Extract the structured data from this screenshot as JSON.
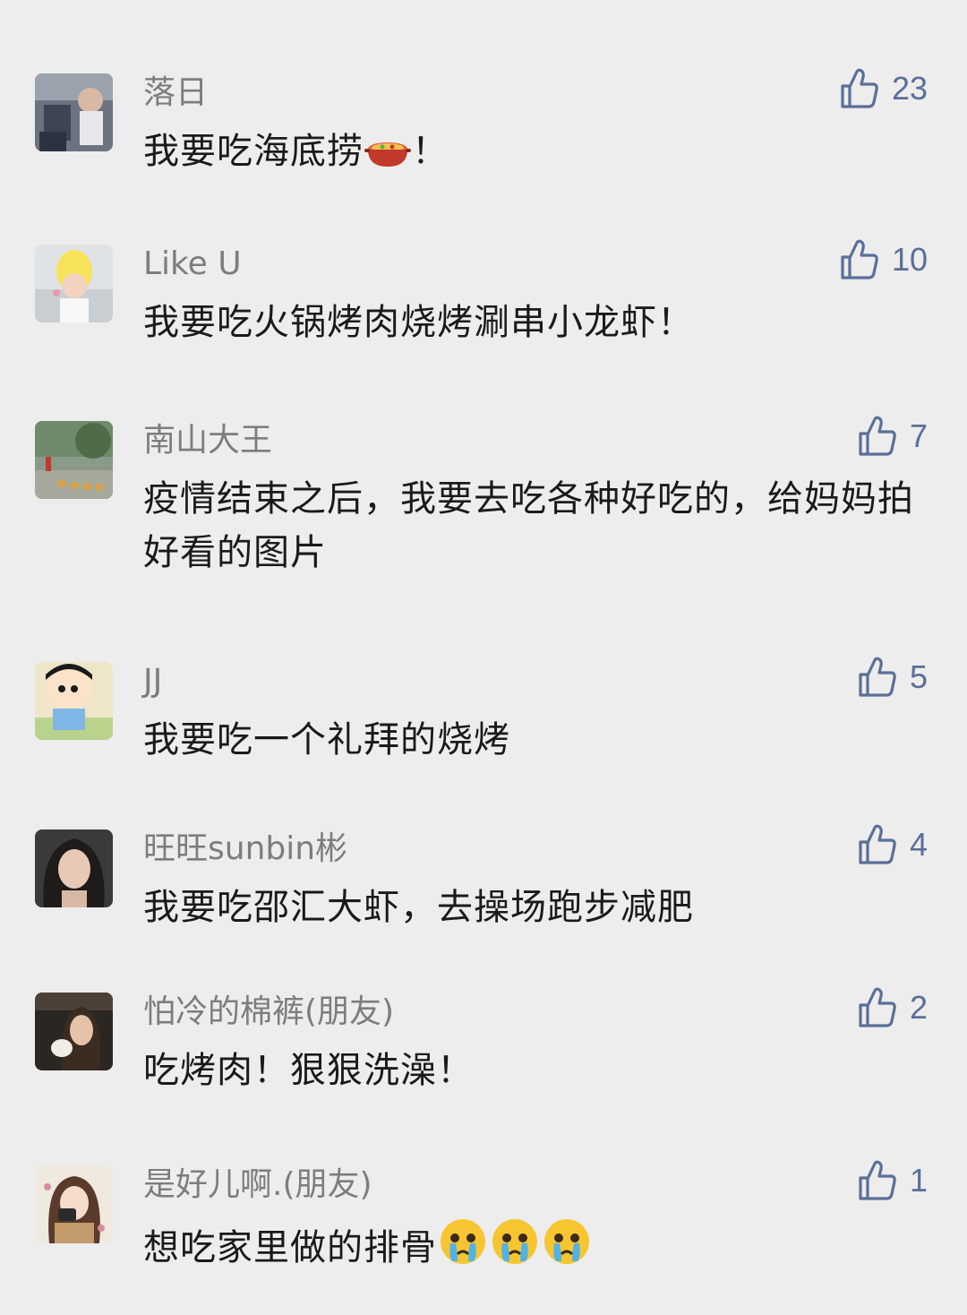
{
  "colors": {
    "background": "#ededed",
    "user_name": "#7d7d7d",
    "comment_text": "#1a1a1a",
    "like_accent": "#5a6f99"
  },
  "comments": [
    {
      "user": "落日",
      "text": "我要吃海底捞",
      "emoji": "hotpot-emoji",
      "text_suffix": "！",
      "likes": "23",
      "like_icon": "thumbs-up-icon"
    },
    {
      "user": "Like U",
      "text": "我要吃火锅烤肉烧烤涮串小龙虾！",
      "likes": "10",
      "like_icon": "thumbs-up-icon"
    },
    {
      "user": "南山大王",
      "text": "疫情结束之后，我要去吃各种好吃的，给妈妈拍好看的图片",
      "likes": "7",
      "like_icon": "thumbs-up-icon"
    },
    {
      "user": "JJ",
      "text": "我要吃一个礼拜的烧烤",
      "likes": "5",
      "like_icon": "thumbs-up-icon"
    },
    {
      "user": "旺旺sunbin彬",
      "text": "我要吃邵汇大虾，去操场跑步减肥",
      "likes": "4",
      "like_icon": "thumbs-up-icon"
    },
    {
      "user": "怕冷的棉裤(朋友)",
      "text": "吃烤肉！狠狠洗澡！",
      "likes": "2",
      "like_icon": "thumbs-up-icon"
    },
    {
      "user": "是好儿啊.(朋友)",
      "text": "想吃家里做的排骨",
      "emoji": "crying-face-emoji",
      "emoji_count": 3,
      "likes": "1",
      "like_icon": "thumbs-up-icon"
    }
  ]
}
